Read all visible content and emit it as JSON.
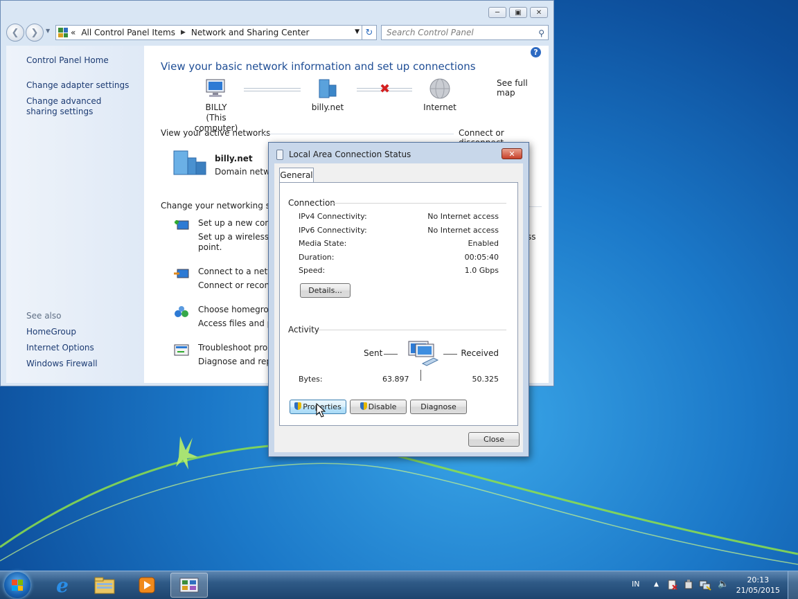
{
  "window": {
    "address": {
      "breadcrumb_chevron": "«",
      "crumb1": "All Control Panel Items",
      "crumb2": "Network and Sharing Center"
    },
    "search_placeholder": "Search Control Panel",
    "caption_buttons": [
      "minimize-icon",
      "maximize-icon",
      "close-icon"
    ]
  },
  "sidebar": {
    "home": "Control Panel Home",
    "adapter": "Change adapter settings",
    "advanced": "Change advanced sharing settings",
    "see_also_title": "See also",
    "see_also": [
      "HomeGroup",
      "Internet Options",
      "Windows Firewall"
    ]
  },
  "content": {
    "heading": "View your basic network information and set up connections",
    "see_full_map": "See full map",
    "map": {
      "computer_name": "BILLY",
      "computer_sub": "(This computer)",
      "network": "billy.net",
      "internet": "Internet"
    },
    "active_networks_label": "View your active networks",
    "connect_disconnect": "Connect or disconnect",
    "active_network_name": "billy.net",
    "active_network_type": "Domain netwo",
    "change_settings_label": "Change your networking setti",
    "tasks": [
      {
        "link": "Set up a new conne",
        "desc": "Set up a wireless, br",
        "desc2": "point.",
        "trail": "ss"
      },
      {
        "link": "Connect to a netwo",
        "desc": "Connect or reconne"
      },
      {
        "link": "Choose homegroup",
        "desc": "Access files and prin"
      },
      {
        "link": "Troubleshoot probl",
        "desc": "Diagnose and repair"
      }
    ]
  },
  "dialog": {
    "title": "Local Area Connection Status",
    "close_glyph": "✕",
    "tab": "General",
    "connection_group": "Connection",
    "rows": [
      {
        "label": "IPv4 Connectivity:",
        "value": "No Internet access"
      },
      {
        "label": "IPv6 Connectivity:",
        "value": "No Internet access"
      },
      {
        "label": "Media State:",
        "value": "Enabled"
      },
      {
        "label": "Duration:",
        "value": "00:05:40"
      },
      {
        "label": "Speed:",
        "value": "1.0 Gbps"
      }
    ],
    "details_button": "Details...",
    "activity_group": "Activity",
    "sent_label": "Sent",
    "received_label": "Received",
    "bytes_label": "Bytes:",
    "bytes_sent": "63.897",
    "bytes_received": "50.325",
    "properties_button": "Properties",
    "disable_button": "Disable",
    "diagnose_button": "Diagnose",
    "close_button": "Close"
  },
  "taskbar": {
    "language": "IN",
    "time": "20:13",
    "date": "21/05/2015",
    "pinned": [
      "internet-explorer-icon",
      "windows-explorer-icon",
      "media-player-icon",
      "control-panel-icon"
    ]
  },
  "colors": {
    "link": "#1b64c8",
    "heading": "#1e4d95",
    "desktop": "#1b78c8"
  }
}
